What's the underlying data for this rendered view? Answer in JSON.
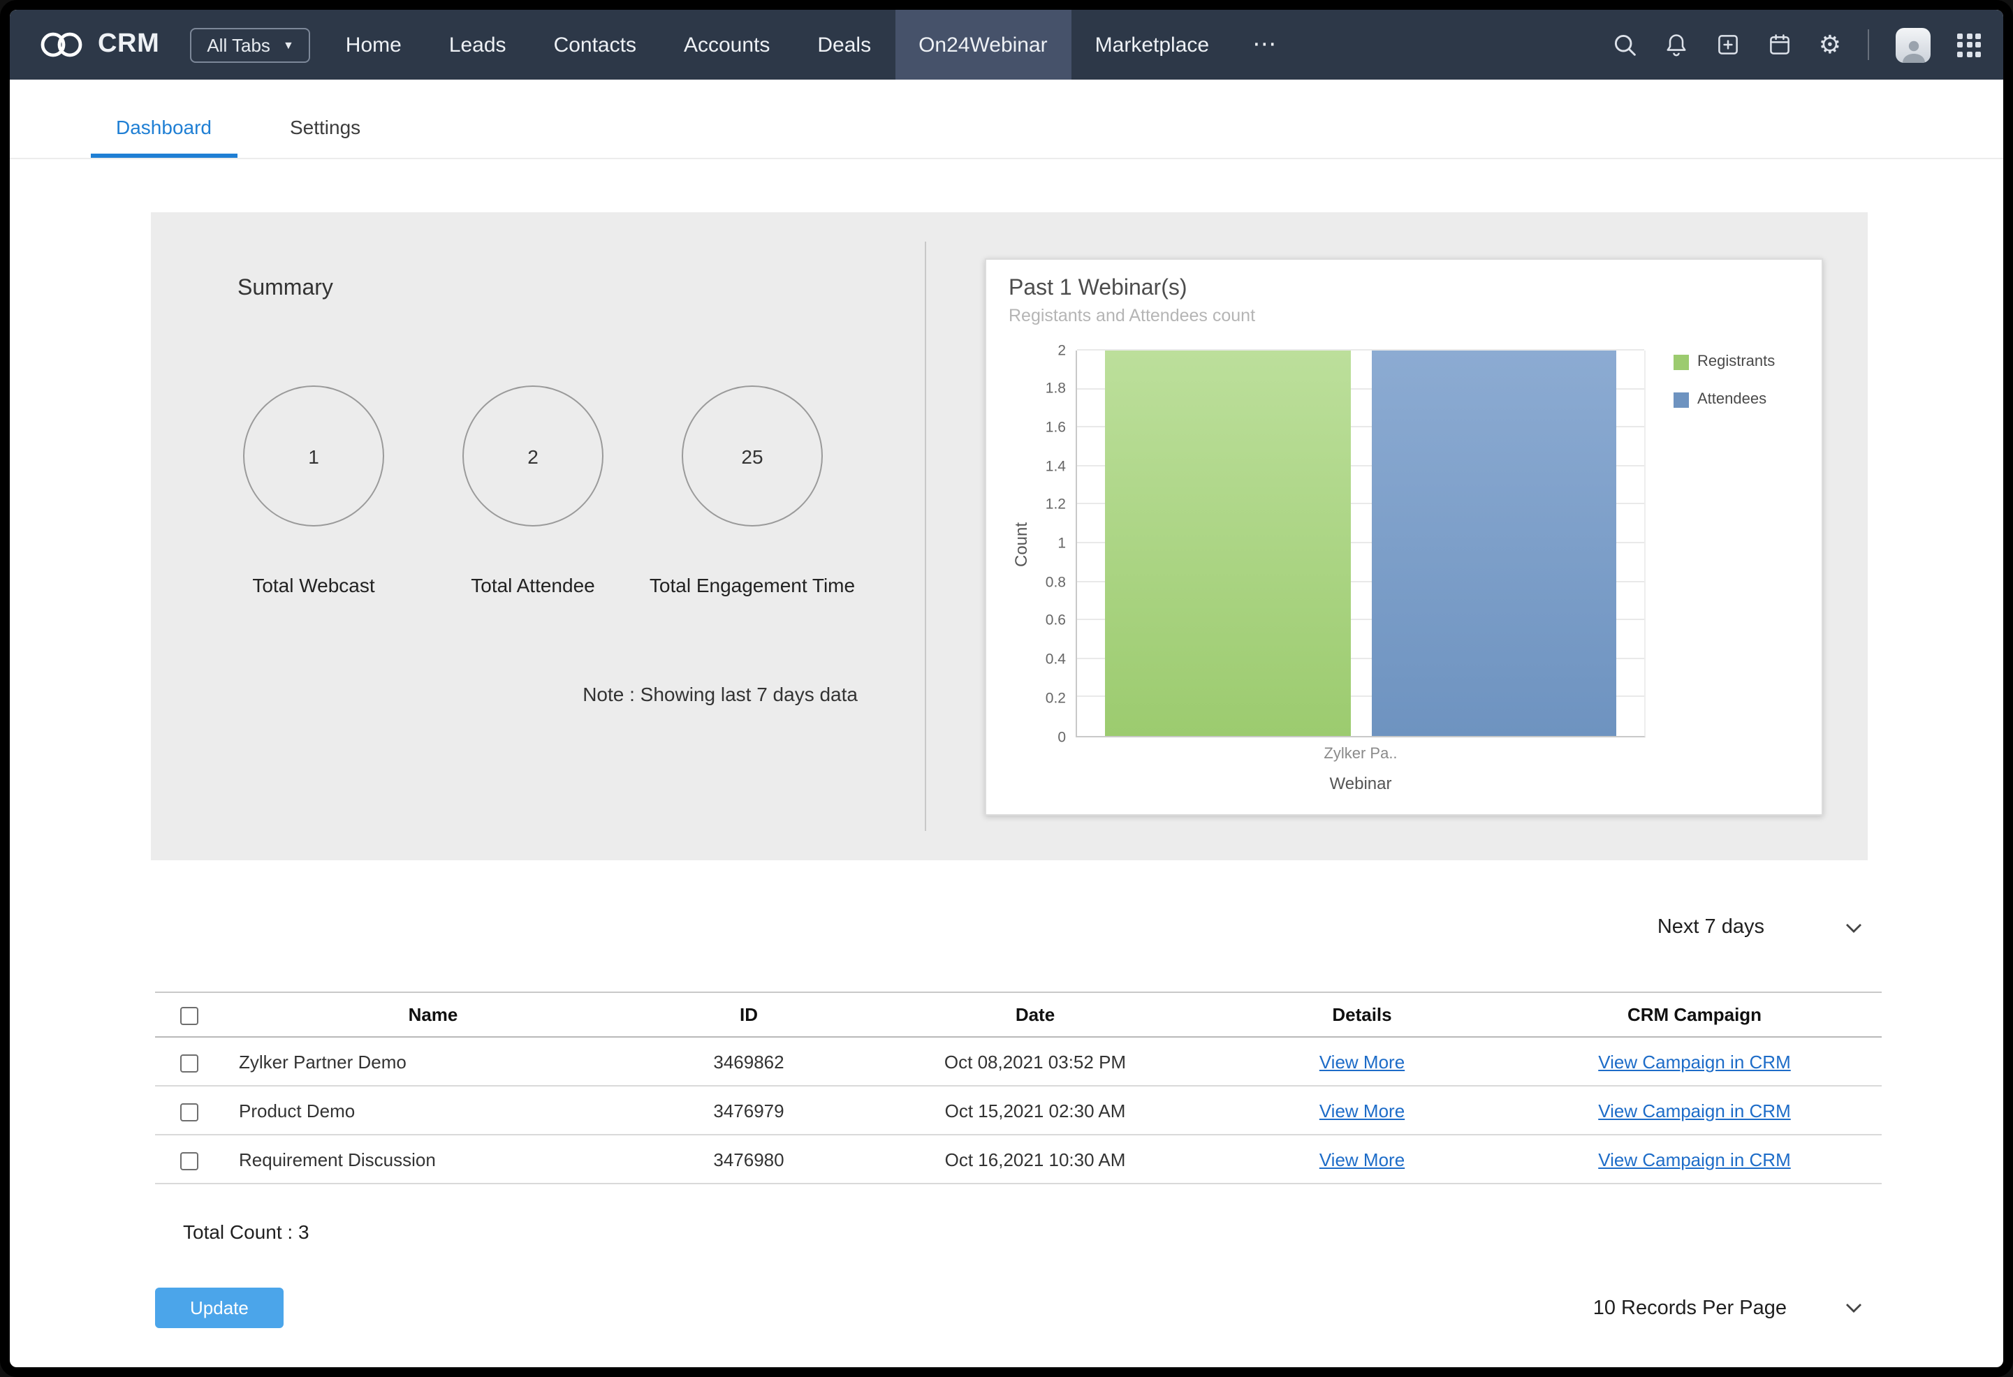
{
  "navbar": {
    "brand": "CRM",
    "all_tabs": "All Tabs",
    "items": [
      "Home",
      "Leads",
      "Contacts",
      "Accounts",
      "Deals",
      "On24Webinar",
      "Marketplace"
    ],
    "more": "⋯"
  },
  "tabs": {
    "dashboard": "Dashboard",
    "settings": "Settings"
  },
  "summary": {
    "title": "Summary",
    "stats": [
      {
        "value": "1",
        "label": "Total Webcast"
      },
      {
        "value": "2",
        "label": "Total Attendee"
      },
      {
        "value": "25",
        "label": "Total Engagement Time"
      }
    ],
    "note": "Note : Showing last 7 days data"
  },
  "chart_data": {
    "type": "bar",
    "title": "Past 1 Webinar(s)",
    "subtitle": "Registants and Attendees count",
    "categories": [
      "Zylker Pa.."
    ],
    "series": [
      {
        "name": "Registrants",
        "values": [
          2
        ],
        "color": "#9ccb6f",
        "color_top": "#bcdf9b"
      },
      {
        "name": "Attendees",
        "values": [
          2
        ],
        "color": "#6e93c0",
        "color_top": "#8cabd2"
      }
    ],
    "xlabel": "Webinar",
    "ylabel": "Count",
    "ylim": [
      0,
      2
    ],
    "yticks": [
      0,
      0.2,
      0.4,
      0.6,
      0.8,
      1,
      1.2,
      1.4,
      1.6,
      1.8,
      2
    ],
    "legend_position": "right",
    "grid": true
  },
  "filter": {
    "range_label": "Next 7 days"
  },
  "table": {
    "headers": [
      "Name",
      "ID",
      "Date",
      "Details",
      "CRM Campaign"
    ],
    "rows": [
      {
        "name": "Zylker Partner Demo",
        "id": "3469862",
        "date": "Oct 08,2021 03:52 PM",
        "details": "View More",
        "campaign": "View Campaign in CRM"
      },
      {
        "name": "Product Demo",
        "id": "3476979",
        "date": "Oct 15,2021 02:30 AM",
        "details": "View More",
        "campaign": "View Campaign in CRM"
      },
      {
        "name": "Requirement Discussion",
        "id": "3476980",
        "date": "Oct 16,2021 10:30 AM",
        "details": "View More",
        "campaign": "View Campaign in CRM"
      }
    ],
    "total_count": "Total Count : 3"
  },
  "footer": {
    "update": "Update",
    "per_page": "10 Records Per Page"
  },
  "colors": {
    "navbar_bg": "#2d3848",
    "active_tab_bg": "#46526a",
    "accent": "#1f7fd4",
    "link": "#1d6cc8",
    "update_button": "#4ba5ea",
    "panel_bg": "#ececec"
  }
}
